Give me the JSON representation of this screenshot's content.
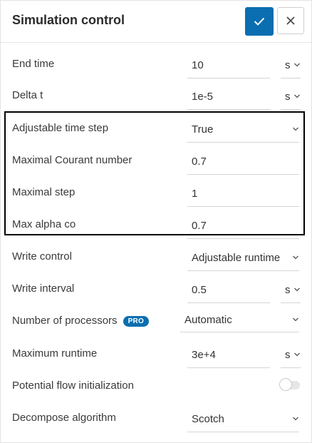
{
  "header": {
    "title": "Simulation control"
  },
  "rows": {
    "end_time": {
      "label": "End time",
      "value": "10",
      "unit": "s"
    },
    "delta_t": {
      "label": "Delta t",
      "value": "1e-5",
      "unit": "s"
    },
    "adjustable_time_step": {
      "label": "Adjustable time step",
      "value": "True"
    },
    "max_courant": {
      "label": "Maximal Courant number",
      "value": "0.7"
    },
    "max_step": {
      "label": "Maximal step",
      "value": "1"
    },
    "max_alpha_co": {
      "label": "Max alpha co",
      "value": "0.7"
    },
    "write_control": {
      "label": "Write control",
      "value": "Adjustable runtime"
    },
    "write_interval": {
      "label": "Write interval",
      "value": "0.5",
      "unit": "s"
    },
    "num_processors": {
      "label": "Number of processors",
      "badge": "PRO",
      "value": "Automatic"
    },
    "max_runtime": {
      "label": "Maximum runtime",
      "value": "3e+4",
      "unit": "s"
    },
    "potential_flow": {
      "label": "Potential flow initialization",
      "enabled": false
    },
    "decompose": {
      "label": "Decompose algorithm",
      "value": "Scotch"
    }
  },
  "colors": {
    "accent": "#0a6eb0",
    "highlight_border": "#000000"
  },
  "icons": {
    "confirm": "checkmark-icon",
    "close": "close-icon",
    "dropdown": "chevron-down-icon"
  }
}
